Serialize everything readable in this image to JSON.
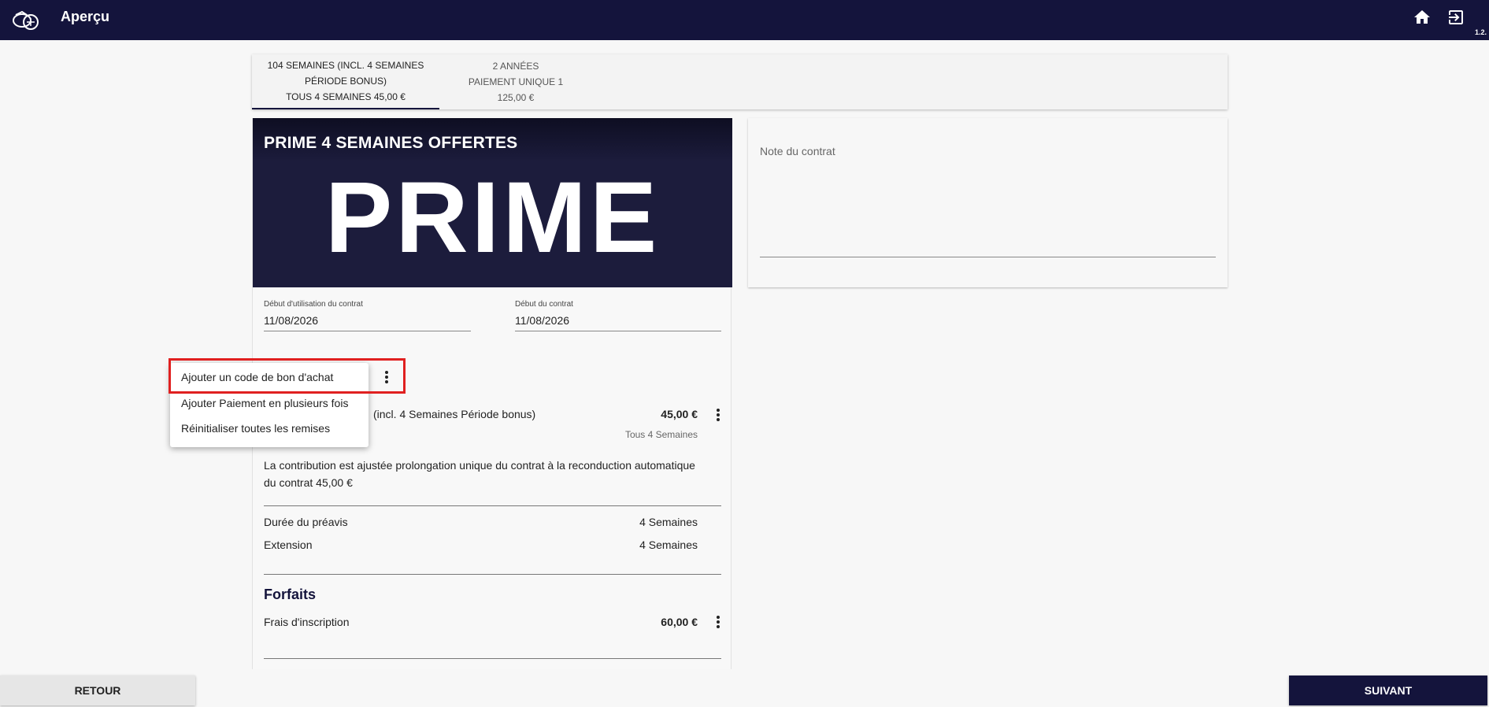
{
  "header": {
    "title": "Aperçu",
    "version": "1.2.",
    "icons": {
      "logo": "brand-logo-icon",
      "home": "home-icon",
      "exit": "exit-icon"
    }
  },
  "tabs": [
    {
      "line1": "104 SEMAINES (INCL. 4 SEMAINES",
      "line2": "PÉRIODE BONUS)",
      "line3": "TOUS 4 SEMAINES 45,00 €"
    },
    {
      "line1": "2 ANNÉES",
      "line2": "PAIEMENT UNIQUE 1 125,00 €"
    }
  ],
  "banner": {
    "title": "PRIME 4 SEMAINES OFFERTES",
    "word": "PRIME"
  },
  "fields": {
    "usage_start": {
      "label": "Début d'utilisation du contrat",
      "value": "11/08/2026"
    },
    "contract_start": {
      "label": "Début du contrat",
      "value": "11/08/2026"
    }
  },
  "plan": {
    "name_partial": "(incl. 4 Semaines Période bonus)",
    "price": "45,00 €",
    "frequency": "Tous 4 Semaines"
  },
  "contribution_text": "La contribution est ajustée prolongation unique du contrat à la reconduction automatique du contrat 45,00 €",
  "terms": [
    {
      "label": "Durée du préavis",
      "value": "4 Semaines"
    },
    {
      "label": "Extension",
      "value": "4 Semaines"
    }
  ],
  "forfaits": {
    "title": "Forfaits",
    "items": [
      {
        "label": "Frais d'inscription",
        "price": "60,00 €"
      }
    ]
  },
  "note": {
    "label": "Note du contrat"
  },
  "menu": {
    "items": [
      "Ajouter un code de bon d'achat",
      "Ajouter Paiement en plusieurs fois",
      "Réinitialiser toutes les remises"
    ]
  },
  "buttons": {
    "back": "RETOUR",
    "next": "SUIVANT"
  },
  "colors": {
    "navy": "#14143c",
    "highlight": "#e02020"
  }
}
